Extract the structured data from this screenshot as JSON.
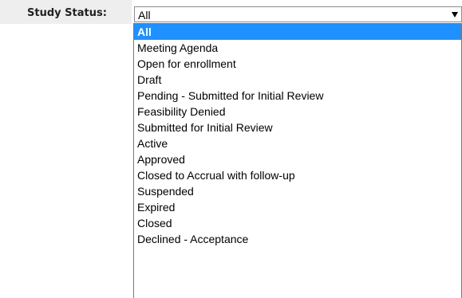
{
  "filter": {
    "label": "Study Status:",
    "selected_value": "All",
    "options": [
      "All",
      "Meeting Agenda",
      "Open for enrollment",
      "Draft",
      "Pending - Submitted for Initial Review",
      "Feasibility Denied",
      "Submitted for Initial Review",
      "Active",
      "Approved",
      "Closed to Accrual with follow-up",
      "Suspended",
      "Expired",
      "Closed",
      "Declined - Acceptance"
    ],
    "highlighted_index": 0,
    "highlight_color": "#1e90ff",
    "arrow_icon": "triangle-down-icon"
  }
}
